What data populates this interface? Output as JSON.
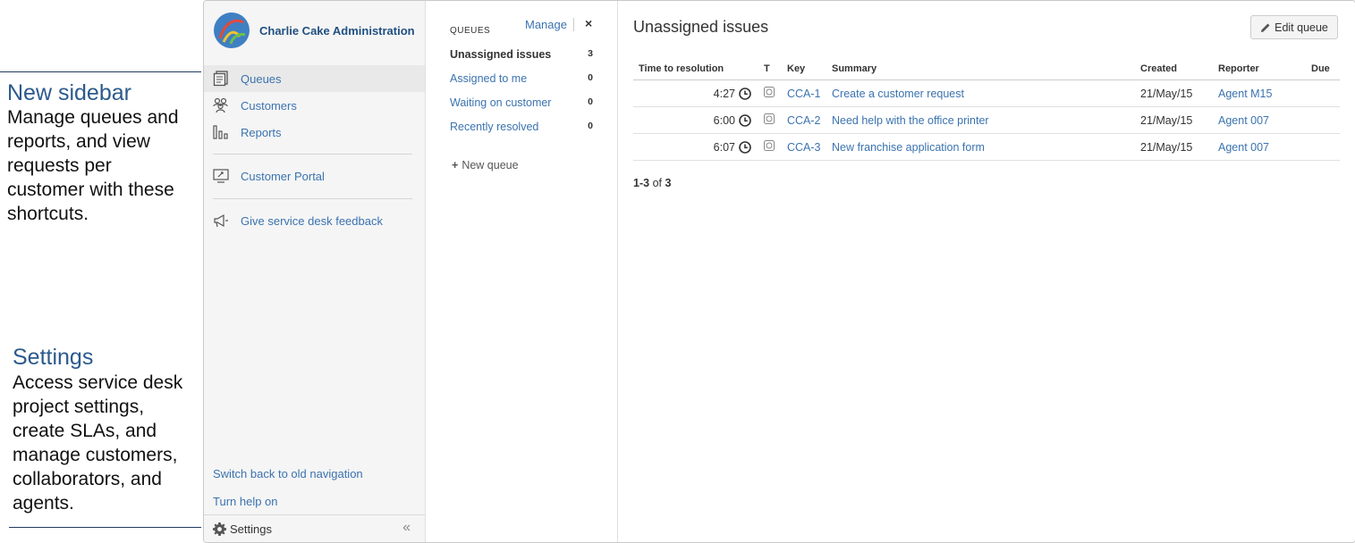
{
  "annotations": {
    "sidebar": {
      "heading": "New sidebar",
      "lines": [
        "Manage queues and",
        "reports, and view",
        "requests per",
        "customer with these",
        "shortcuts."
      ]
    },
    "settings": {
      "heading": "Settings",
      "lines": [
        "Access service desk",
        "project settings,",
        "create SLAs, and",
        "manage customers,",
        "collaborators, and",
        "agents."
      ]
    }
  },
  "sidebar": {
    "project_name": "Charlie Cake Administration",
    "items": [
      {
        "label": "Queues",
        "icon": "queues-icon"
      },
      {
        "label": "Customers",
        "icon": "customers-icon"
      },
      {
        "label": "Reports",
        "icon": "reports-icon"
      },
      {
        "label": "Customer Portal",
        "icon": "customer-portal-icon"
      },
      {
        "label": "Give service desk feedback",
        "icon": "megaphone-icon"
      }
    ],
    "switch_nav": "Switch back to old navigation",
    "help": "Turn help on",
    "settings": "Settings",
    "collapse": "«"
  },
  "queues_panel": {
    "heading": "QUEUES",
    "manage": "Manage",
    "close": "×",
    "items": [
      {
        "label": "Unassigned issues",
        "count": "3"
      },
      {
        "label": "Assigned to me",
        "count": "0"
      },
      {
        "label": "Waiting on customer",
        "count": "0"
      },
      {
        "label": "Recently resolved",
        "count": "0"
      }
    ],
    "new_queue": "New queue"
  },
  "main": {
    "title": "Unassigned issues",
    "edit_button": "Edit queue",
    "columns": [
      "Time to resolution",
      "T",
      "Key",
      "Summary",
      "Created",
      "Reporter",
      "Due"
    ],
    "rows": [
      {
        "time": "4:27",
        "key": "CCA-1",
        "summary": "Create a customer request",
        "created": "21/May/15",
        "reporter": "Agent M15",
        "due": ""
      },
      {
        "time": "6:00",
        "key": "CCA-2",
        "summary": "Need help with the office printer",
        "created": "21/May/15",
        "reporter": "Agent 007",
        "due": ""
      },
      {
        "time": "6:07",
        "key": "CCA-3",
        "summary": "New franchise application form",
        "created": "21/May/15",
        "reporter": "Agent 007",
        "due": ""
      }
    ],
    "pager": {
      "range": "1-3",
      "of": "of",
      "total": "3"
    }
  },
  "colors": {
    "link": "#3b73af",
    "annotation_heading": "#2b5a8c",
    "project_name": "#205081"
  }
}
